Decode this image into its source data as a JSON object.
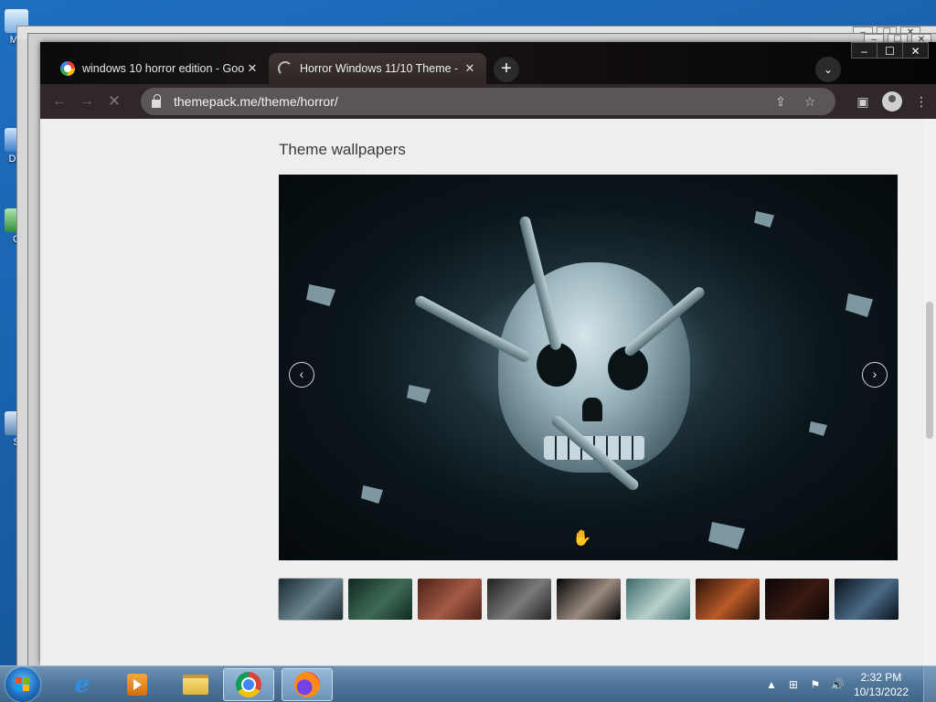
{
  "desktop": {
    "icons": [
      "My",
      "Dat",
      "C",
      "S"
    ]
  },
  "chrome": {
    "tabs": [
      {
        "title": "windows 10 horror edition - Goo",
        "close": "✕",
        "favicon": "google-icon"
      },
      {
        "title": "Horror Windows 11/10 Theme - ",
        "close": "✕",
        "favicon": "loading-spinner-icon"
      }
    ],
    "new_tab": "+",
    "tab_search": "⌄",
    "window_controls": {
      "minimize": "–",
      "maximize": "☐",
      "close": "✕"
    },
    "toolbar": {
      "back": "←",
      "forward": "→",
      "stop": "✕"
    },
    "url": "themepack.me/theme/horror/",
    "omnibox_icons": {
      "share": "⇪",
      "bookmark": "☆"
    },
    "right_icons": {
      "sidepanel": "▣",
      "menu": "⋮"
    }
  },
  "page": {
    "section_title": "Theme wallpapers",
    "carousel": {
      "prev": "‹",
      "next": "›"
    },
    "thumbnails": [
      {
        "colors": [
          "#1a2930",
          "#6a8590"
        ]
      },
      {
        "colors": [
          "#0f2a20",
          "#3f6a55"
        ]
      },
      {
        "colors": [
          "#4a2218",
          "#a55a45"
        ]
      },
      {
        "colors": [
          "#202020",
          "#7a7a7a"
        ]
      },
      {
        "colors": [
          "#050505",
          "#9a8a80"
        ]
      },
      {
        "colors": [
          "#3a6a68",
          "#b8d0cc"
        ]
      },
      {
        "colors": [
          "#2a1208",
          "#b85a28"
        ]
      },
      {
        "colors": [
          "#0a0606",
          "#3a1a12"
        ]
      },
      {
        "colors": [
          "#08121a",
          "#4a6a86"
        ]
      }
    ]
  },
  "taskbar": {
    "clock_time": "2:32 PM",
    "clock_date": "10/13/2022",
    "tray": {
      "arrow": "▲",
      "network": "⊞",
      "flag": "⚑",
      "volume": "🔊"
    }
  },
  "colors": {
    "tab_strip": "#121010",
    "toolbar": "#302828",
    "omnibox": "#5b5555",
    "page_bg": "#eeeeee",
    "taskbar": "#4f7599"
  }
}
